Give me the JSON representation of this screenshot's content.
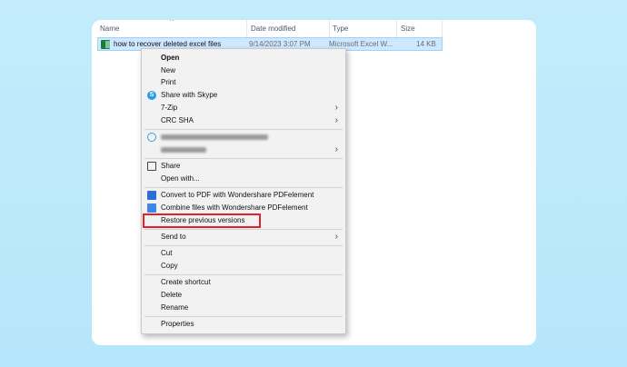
{
  "header": {
    "sort_arrow": "^",
    "columns": [
      "Name",
      "Date modified",
      "Type",
      "Size"
    ]
  },
  "file": {
    "name": "how to recover deleted excel files",
    "date_modified": "9/14/2023 3:07 PM",
    "type": "Microsoft Excel W...",
    "size": "14 KB",
    "icon": "excel-file-icon"
  },
  "menu": {
    "open": "Open",
    "new": "New",
    "print": "Print",
    "share_with_skype": "Share with Skype",
    "seven_zip": "7-Zip",
    "crc_sha": "CRC SHA",
    "share": "Share",
    "open_with": "Open with...",
    "convert_pdf": "Convert to PDF with Wondershare PDFelement",
    "combine_files": "Combine files with Wondershare PDFelement",
    "restore_previous": "Restore previous versions",
    "send_to": "Send to",
    "cut": "Cut",
    "copy": "Copy",
    "create_shortcut": "Create shortcut",
    "delete": "Delete",
    "rename": "Rename",
    "properties": "Properties",
    "chevron": "›"
  },
  "colors": {
    "highlight": "#e3202c",
    "selection": "#cde8ff",
    "background": "#bfe9fb"
  }
}
